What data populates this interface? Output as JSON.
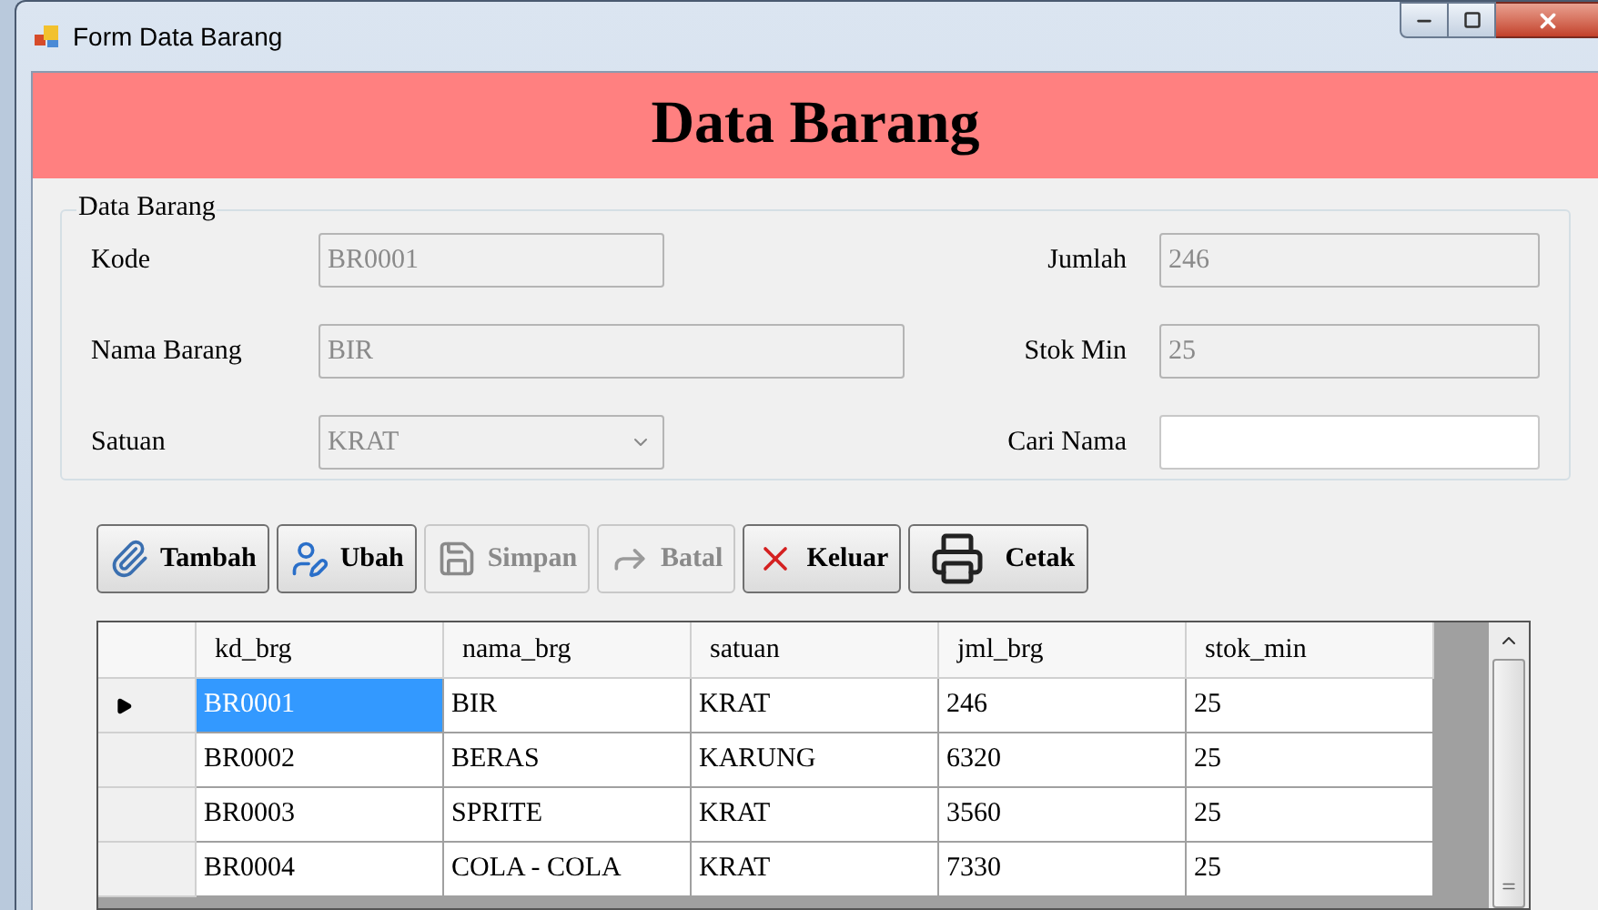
{
  "window": {
    "title": "Form Data Barang"
  },
  "header": "Data Barang",
  "group": {
    "title": "Data Barang",
    "left_fields": [
      {
        "label": "Kode",
        "value": "BR0001",
        "disabled": true,
        "kind": "text"
      },
      {
        "label": "Nama Barang",
        "value": "BIR",
        "disabled": true,
        "kind": "text"
      },
      {
        "label": "Satuan",
        "value": "KRAT",
        "disabled": true,
        "kind": "combo"
      }
    ],
    "right_fields": [
      {
        "label": "Jumlah",
        "value": "246",
        "disabled": true,
        "kind": "text"
      },
      {
        "label": "Stok Min",
        "value": "25",
        "disabled": true,
        "kind": "text"
      },
      {
        "label": "Cari Nama",
        "disabled": false,
        "kind": "text"
      }
    ]
  },
  "buttons": [
    {
      "label": "Tambah",
      "disabled": false
    },
    {
      "label": "Ubah",
      "disabled": false
    },
    {
      "label": "Simpan",
      "disabled": true
    },
    {
      "label": "Batal",
      "disabled": true
    },
    {
      "label": "Keluar",
      "disabled": false
    },
    {
      "label": "Cetak",
      "disabled": false
    }
  ],
  "table": {
    "columns": [
      "kd_brg",
      "nama_brg",
      "satuan",
      "jml_brg",
      "stok_min"
    ],
    "rows": [
      {
        "cells": [
          "BR0001",
          "BIR",
          "KRAT",
          "246",
          "25"
        ],
        "selected": true
      },
      {
        "cells": [
          "BR0002",
          "BERAS",
          "KARUNG",
          "6320",
          "25"
        ],
        "selected": false
      },
      {
        "cells": [
          "BR0003",
          "SPRITE",
          "KRAT",
          "3560",
          "25"
        ],
        "selected": false
      },
      {
        "cells": [
          "BR0004",
          "COLA - COLA",
          "KRAT",
          "7330",
          "25"
        ],
        "selected": false
      }
    ]
  }
}
